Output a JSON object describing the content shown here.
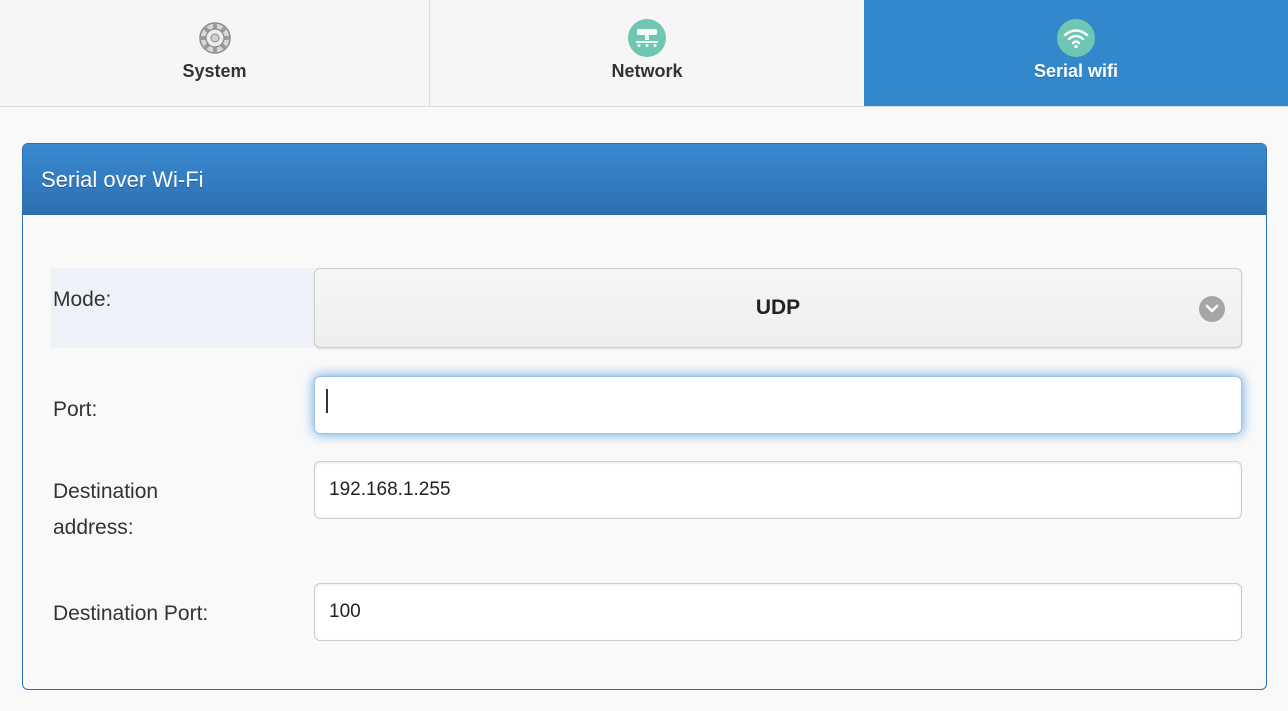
{
  "tabs": [
    {
      "label": "System",
      "icon": "gear-icon",
      "active": false
    },
    {
      "label": "Network",
      "icon": "network-icon",
      "active": false
    },
    {
      "label": "Serial wifi",
      "icon": "wifi-icon",
      "active": true
    }
  ],
  "panel": {
    "title": "Serial over Wi-Fi"
  },
  "form": {
    "mode_label": "Mode:",
    "mode_value": "UDP",
    "port_label": "Port:",
    "port_value": "",
    "dest_address_label_line1": "Destination",
    "dest_address_label_line2": "address:",
    "dest_address_value": "192.168.1.255",
    "dest_port_label": "Destination Port:",
    "dest_port_value": "100"
  },
  "colors": {
    "accent": "#3388cc",
    "icon_bg": "#6dc7b2",
    "panel_border": "#2a6fb4"
  }
}
